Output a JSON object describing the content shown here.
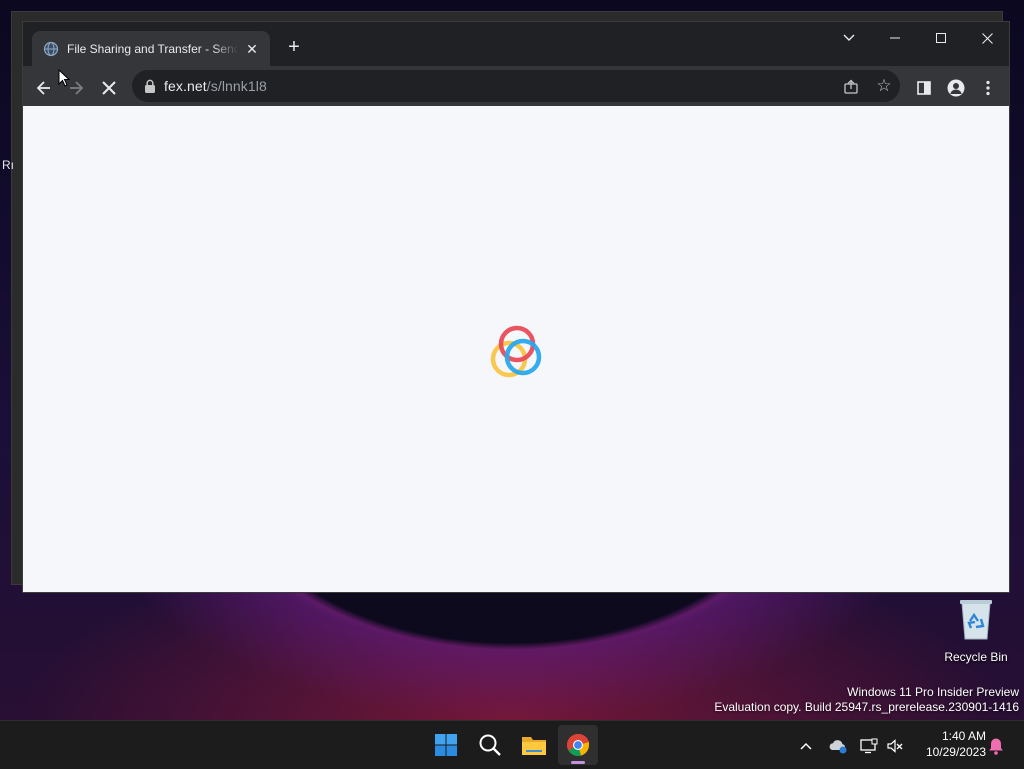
{
  "desktop": {
    "background_window_peek_text": "Rı",
    "recycle_bin": {
      "label": "Recycle Bin"
    },
    "watermark": {
      "line1": "Windows 11 Pro Insider Preview",
      "line2": "Evaluation copy. Build 25947.rs_prerelease.230901-1416"
    }
  },
  "browser": {
    "tab": {
      "title": "File Sharing and Transfer - Send Files Securely",
      "favicon": "fex-globe-icon",
      "close_glyph": "✕"
    },
    "new_tab_glyph": "+",
    "window_controls": {
      "tab_search": "⌄",
      "minimize": "—",
      "maximize": "☐",
      "close": "✕"
    },
    "toolbar": {
      "back_glyph": "←",
      "forward_glyph": "→",
      "stop_glyph": "✕"
    },
    "omnibox": {
      "url_host": "fex.net",
      "url_path": "/s/lnnk1l8",
      "share_icon": "share-icon",
      "bookmark_glyph": "☆"
    },
    "page": {
      "state": "loading",
      "spinner_colors": [
        "#e94a56",
        "#f9c23c",
        "#2aa8ec"
      ]
    }
  },
  "taskbar": {
    "apps": [
      {
        "name": "start",
        "active": false
      },
      {
        "name": "search",
        "active": false
      },
      {
        "name": "file-explorer",
        "active": false
      },
      {
        "name": "chrome",
        "active": true
      }
    ],
    "tray": {
      "overflow_glyph": "⌃",
      "clock_time": "1:40 AM",
      "clock_date": "10/29/2023"
    }
  },
  "colors": {
    "chrome_frame": "#202124",
    "chrome_toolbar": "#35363a",
    "page_bg": "#f5f7fb",
    "taskbar_bg": "#1c1c1c",
    "accent_active": "#c291e0"
  }
}
